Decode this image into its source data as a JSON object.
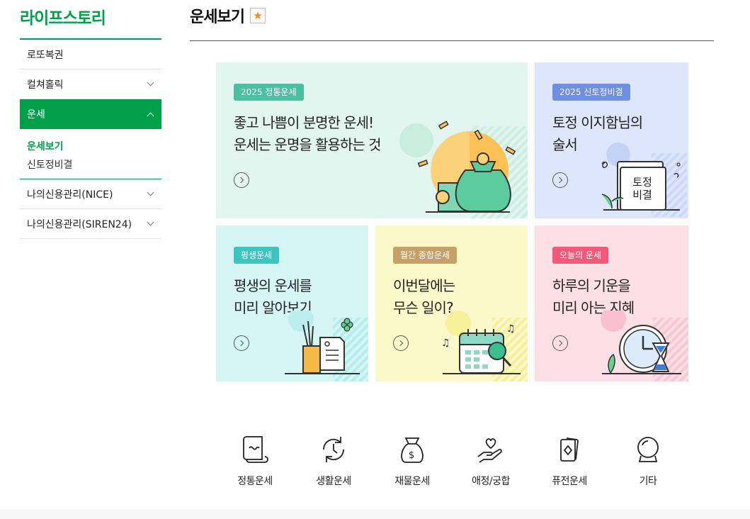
{
  "brand": "라이프스토리",
  "sidebar": {
    "items": [
      {
        "label": "로또복권"
      },
      {
        "label": "컬쳐홀릭"
      },
      {
        "label": "운세"
      },
      {
        "label": "나의신용관리(NICE)"
      },
      {
        "label": "나의신용관리(SIREN24)"
      }
    ],
    "sub_items": [
      {
        "label": "운세보기"
      },
      {
        "label": "신토정비결"
      }
    ]
  },
  "header": {
    "title": "운세보기"
  },
  "cards": [
    {
      "tag": "2025 정통운세",
      "title": "좋고 나쁨이 분명한 운세!\n운세는 운명을 활용하는 것",
      "bg": "#e2f5ef",
      "tag_color": "#4bbfa0"
    },
    {
      "tag": "2025 신토정비결",
      "title": "토정 이지함님의\n술서",
      "bg": "#dde6fb",
      "tag_color": "#6f8fe0",
      "book_text": "토정\n비결"
    },
    {
      "tag": "평생운세",
      "title": "평생의 운세를\n미리 알아보기",
      "bg": "#d6f6f6",
      "tag_color": "#3cc4c1"
    },
    {
      "tag": "월간 종합운세",
      "title": "이번달에는\n무슨 일이?",
      "bg": "#fbf9c9",
      "tag_color": "#c7a067"
    },
    {
      "tag": "오늘의 운세",
      "title": "하루의 기운을\n미리 아는 지혜",
      "bg": "#fde0e6",
      "tag_color": "#f05a78"
    }
  ],
  "categories": [
    {
      "label": "정통운세",
      "icon": "scroll-icon"
    },
    {
      "label": "생활운세",
      "icon": "cycle-icon"
    },
    {
      "label": "재물운세",
      "icon": "money-bag-icon"
    },
    {
      "label": "애정/궁합",
      "icon": "heart-hand-icon"
    },
    {
      "label": "퓨전운세",
      "icon": "cards-icon"
    },
    {
      "label": "기타",
      "icon": "crystal-ball-icon"
    }
  ],
  "colors": {
    "brand": "#00a04b",
    "star": "#f18a26"
  }
}
